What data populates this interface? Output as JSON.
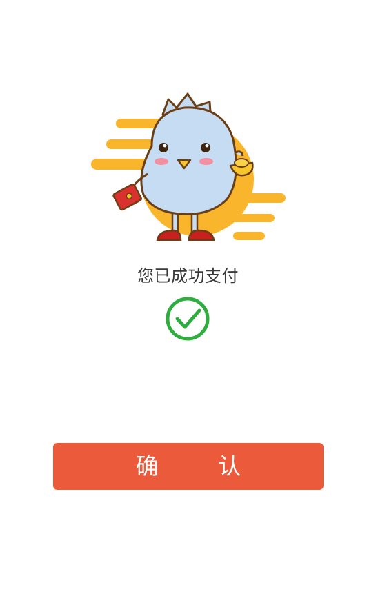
{
  "status": {
    "message": "您已成功支付"
  },
  "icons": {
    "mascot": "chick-mascot-with-red-envelope-and-gold-ingot",
    "success": "check-circle-icon"
  },
  "actions": {
    "confirm_label": "确 认"
  },
  "colors": {
    "confirm_button": "#ec5a3c",
    "success_green": "#2fae3f",
    "mascot_backdrop": "#f9b52b",
    "mascot_body": "#c5dcf3"
  }
}
